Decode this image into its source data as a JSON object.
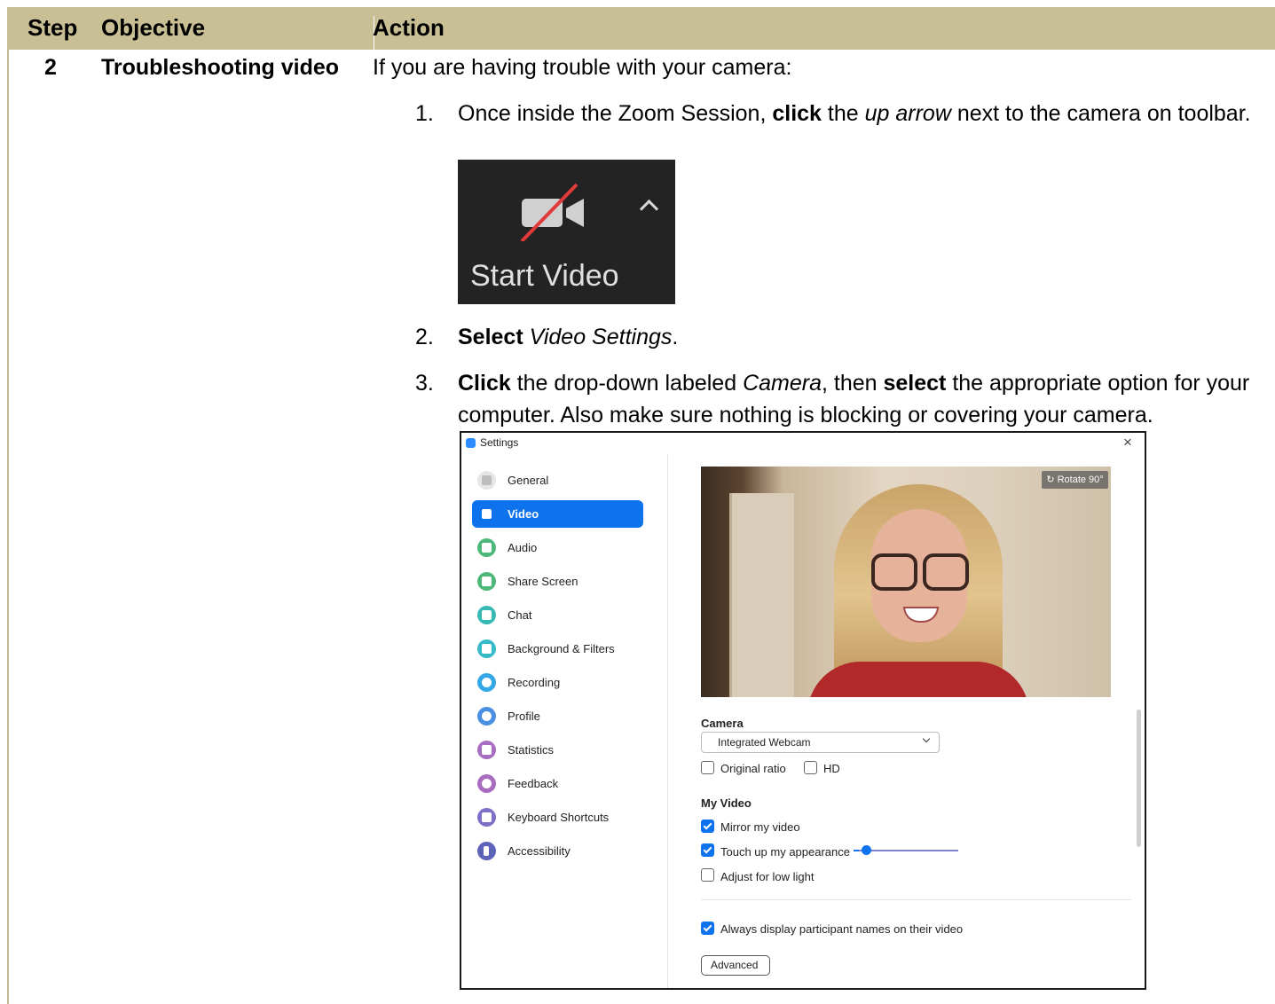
{
  "table": {
    "headers": [
      "Step",
      "Objective",
      "Action"
    ],
    "row": {
      "step": "2",
      "objective": "Troubleshooting video",
      "intro": "If you are having trouble with your camera:"
    }
  },
  "steps": [
    {
      "num": "1.",
      "parts": [
        {
          "t": "Once inside the Zoom Session, ",
          "s": ""
        },
        {
          "t": "click",
          "s": "b"
        },
        {
          "t": " the ",
          "s": ""
        },
        {
          "t": "up arrow",
          "s": "i"
        },
        {
          "t": " next to the camera on toolbar.",
          "s": ""
        }
      ]
    },
    {
      "num": "2.",
      "parts": [
        {
          "t": "Select",
          "s": "b"
        },
        {
          "t": " ",
          "s": ""
        },
        {
          "t": "Video Settings",
          "s": "i"
        },
        {
          "t": ".",
          "s": ""
        }
      ]
    },
    {
      "num": "3.",
      "parts": [
        {
          "t": "Click",
          "s": "b"
        },
        {
          "t": " the drop-down labeled ",
          "s": ""
        },
        {
          "t": "Camera",
          "s": "i"
        },
        {
          "t": ", then ",
          "s": ""
        },
        {
          "t": "select",
          "s": "b"
        },
        {
          "t": " the appropriate option for your computer. Also make sure nothing is blocking or covering your camera.",
          "s": ""
        }
      ]
    }
  ],
  "start_video": {
    "label": "Start Video",
    "camera_icon": "video-off-icon",
    "caret_icon": "chevron-up-icon"
  },
  "settings": {
    "title": "Settings",
    "close_glyph": "×",
    "nav": [
      {
        "label": "General",
        "icon": "gear-icon",
        "color": "#e9e9e9",
        "active": false
      },
      {
        "label": "Video",
        "icon": "video-icon",
        "color": "#0e72ed",
        "active": true
      },
      {
        "label": "Audio",
        "icon": "headphones-icon",
        "color": "#4db87a",
        "active": false
      },
      {
        "label": "Share Screen",
        "icon": "share-screen-icon",
        "color": "#4db87a",
        "active": false
      },
      {
        "label": "Chat",
        "icon": "chat-icon",
        "color": "#36b9b2",
        "active": false
      },
      {
        "label": "Background & Filters",
        "icon": "background-icon",
        "color": "#36b9c8",
        "active": false
      },
      {
        "label": "Recording",
        "icon": "recording-icon",
        "color": "#34a8e6",
        "active": false
      },
      {
        "label": "Profile",
        "icon": "profile-icon",
        "color": "#4a90e2",
        "active": false
      },
      {
        "label": "Statistics",
        "icon": "statistics-icon",
        "color": "#a86cc1",
        "active": false
      },
      {
        "label": "Feedback",
        "icon": "feedback-icon",
        "color": "#a86cc1",
        "active": false
      },
      {
        "label": "Keyboard Shortcuts",
        "icon": "keyboard-icon",
        "color": "#7f6fc9",
        "active": false
      },
      {
        "label": "Accessibility",
        "icon": "accessibility-icon",
        "color": "#5d63b8",
        "active": false
      }
    ],
    "rotate_label": "↻ Rotate 90°",
    "camera_label": "Camera",
    "camera_value": "Integrated Webcam",
    "original_ratio": {
      "label": "Original ratio",
      "checked": false
    },
    "hd": {
      "label": "HD",
      "checked": false
    },
    "my_video_label": "My Video",
    "mirror": {
      "label": "Mirror my video",
      "checked": true
    },
    "touch_up": {
      "label": "Touch up my appearance",
      "checked": true,
      "level": 0.12
    },
    "low_light": {
      "label": "Adjust for low light",
      "checked": false
    },
    "names": {
      "label": "Always display participant names on their video",
      "checked": true
    },
    "advanced_label": "Advanced"
  }
}
